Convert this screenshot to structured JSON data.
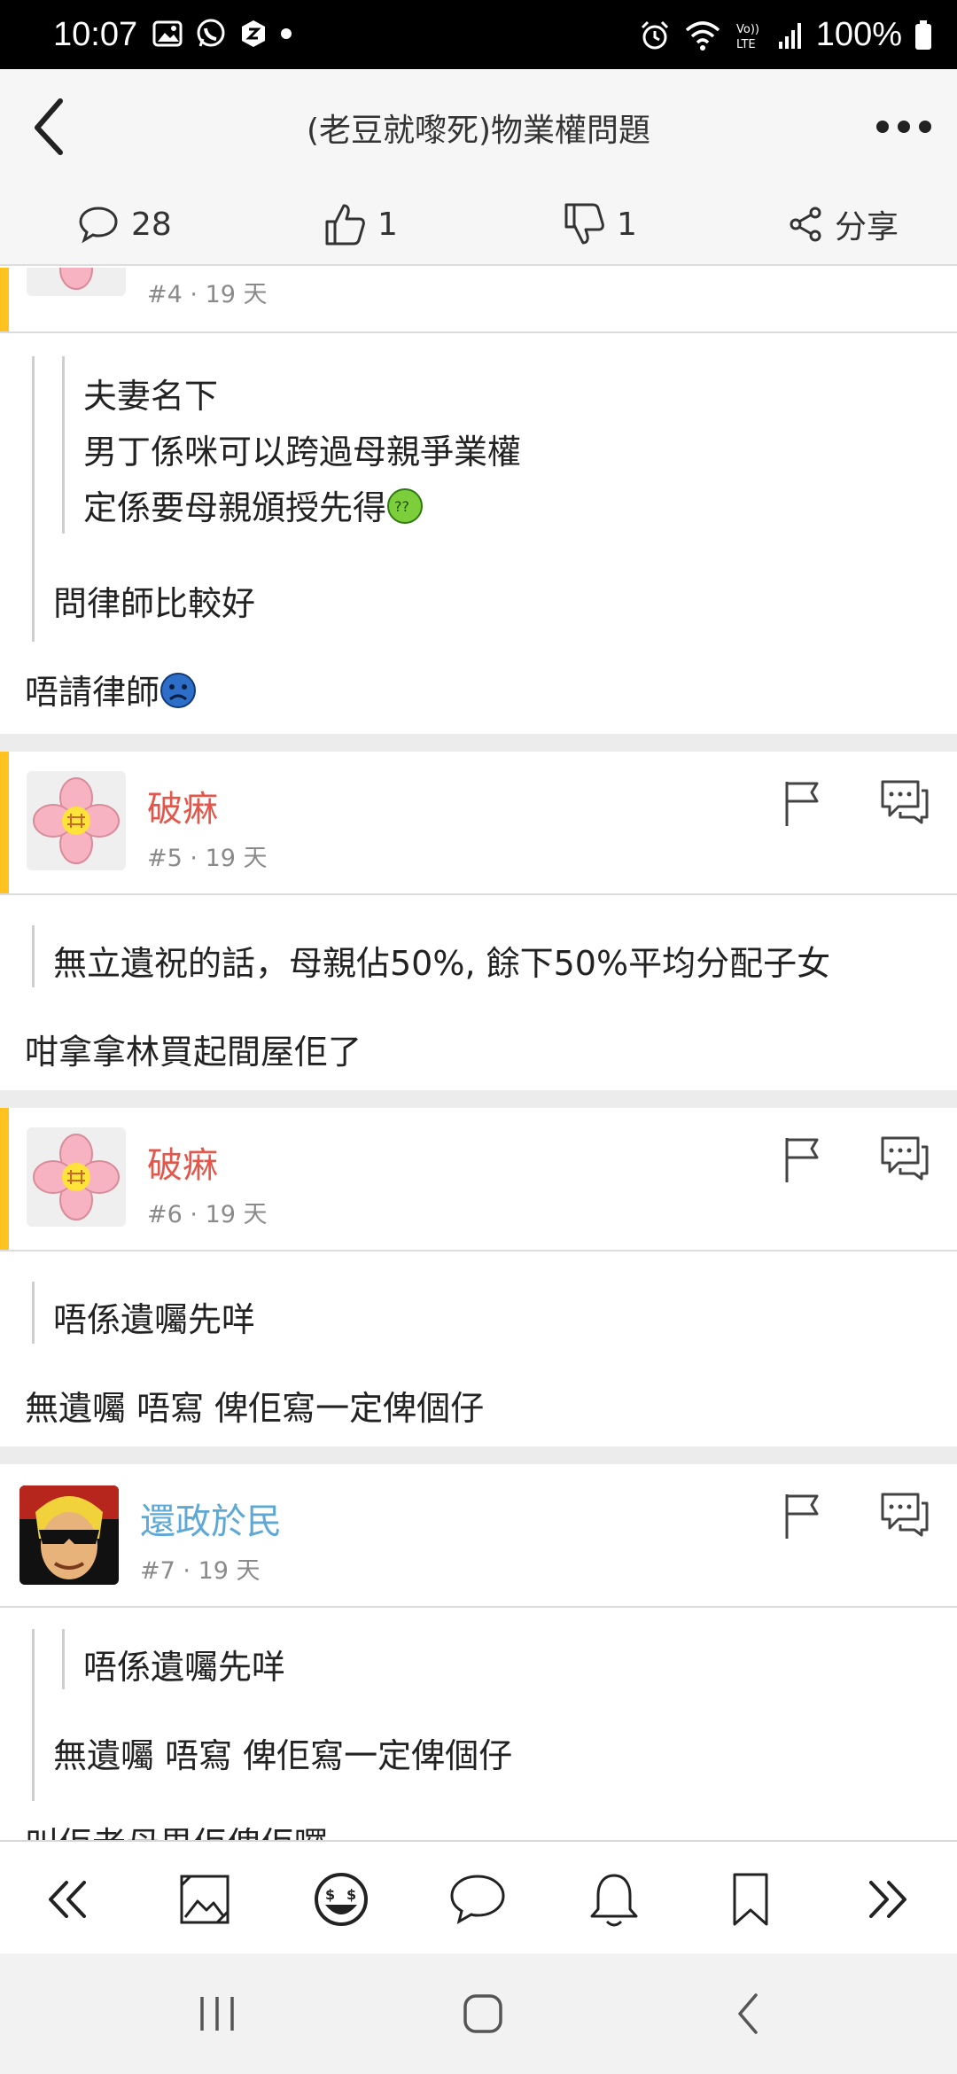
{
  "status_bar": {
    "time": "10:07",
    "battery": "100%",
    "left_icons": [
      "gallery-icon",
      "whatsapp-icon",
      "app-icon",
      "dot-icon"
    ],
    "right_icons": [
      "alarm-icon",
      "wifi-icon",
      "volte-icon",
      "signal-icon",
      "battery-icon"
    ]
  },
  "header": {
    "title": "(老豆就嚟死)物業權問題",
    "comments_count": "28",
    "likes_count": "1",
    "dislikes_count": "1",
    "share_label": "分享"
  },
  "posts": [
    {
      "floor": "#4",
      "time": "· 19 天",
      "quote_outer_lines": [
        "問律師比較好"
      ],
      "quote_inner_lines": [
        "夫妻名下",
        "男丁係咪可以跨過母親爭業權",
        "定係要母親頒授先得"
      ],
      "reply_lines": [
        "唔請律師"
      ]
    },
    {
      "username": "破痳",
      "floor": "#5",
      "time": "· 19 天",
      "quote_outer_lines": [
        "無立遺祝的話，母親佔50%, 餘下50%平均分配子女"
      ],
      "reply_lines": [
        "咁拿拿林買起間屋佢了"
      ]
    },
    {
      "username": "破痳",
      "floor": "#6",
      "time": "· 19 天",
      "quote_outer_lines": [
        "唔係遺囑先咩"
      ],
      "reply_lines": [
        "無遺囑 唔寫 俾佢寫一定俾個仔"
      ]
    },
    {
      "username": "還政於民",
      "floor": "#7",
      "time": "· 19 天",
      "quote_inner_lines": [
        "唔係遺囑先咩"
      ],
      "quote_outer_lines": [
        "無遺囑 唔寫 俾佢寫一定俾個仔"
      ],
      "reply_lines": [
        "叫佢老母畀佢俾佢囉"
      ]
    }
  ],
  "toolbar": [
    "first-page-icon",
    "image-icon",
    "emoji-icon",
    "comment-icon",
    "bell-icon",
    "bookmark-icon",
    "last-page-icon"
  ],
  "colors": {
    "accent_bar": "#ffc21f",
    "username_red": "#e4564a",
    "username_blue": "#5ea8d6"
  }
}
